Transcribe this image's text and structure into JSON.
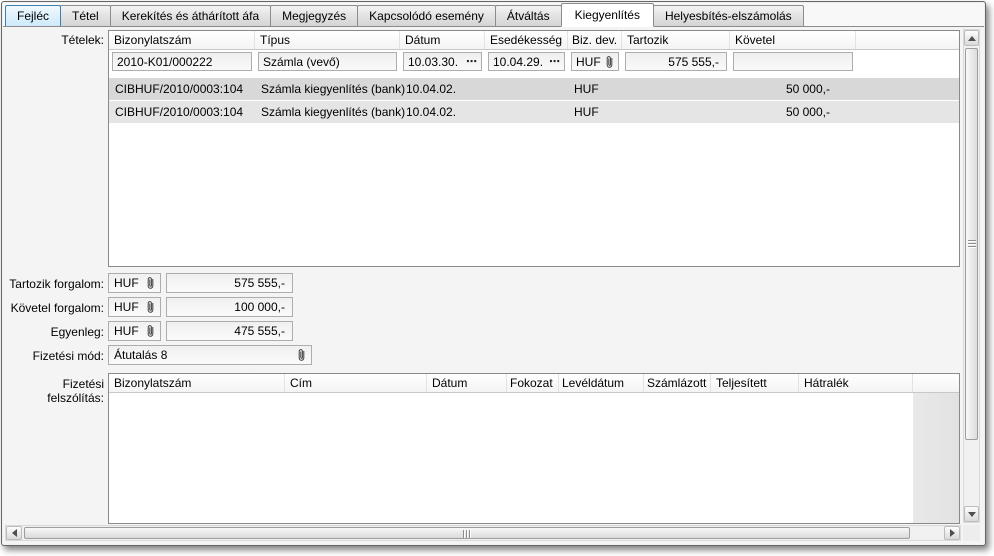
{
  "active_tab": "Kiegyenlítés",
  "tabs": [
    "Fejléc",
    "Tétel",
    "Kerekítés és áthárított áfa",
    "Megjegyzés",
    "Kapcsolódó esemény",
    "Átváltás",
    "Kiegyenlítés",
    "Helyesbítés-elszámolás"
  ],
  "tetelek": {
    "label": "Tételek:",
    "columns": [
      "Bizonylatszám",
      "Típus",
      "Dátum",
      "Esedékesség",
      "Biz. dev.",
      "Tartozik",
      "Követel"
    ],
    "ellipsis": "⋯",
    "editRow": {
      "bizonylatszam": "2010-K01/000222",
      "tipus": "Számla (vevő)",
      "datum": "10.03.30.",
      "esedekesseg": "10.04.29.",
      "bizdev": "HUF",
      "tartozik": "575 555,-",
      "kovetel": ""
    },
    "rows": [
      {
        "bizonylatszam": "CIBHUF/2010/0003:104",
        "tipus": "Számla kiegyenlítés (bank)",
        "datum": "10.04.02.",
        "bizdev": "HUF",
        "kovetel": "50 000,-"
      },
      {
        "bizonylatszam": "CIBHUF/2010/0003:104",
        "tipus": "Számla kiegyenlítés (bank)",
        "datum": "10.04.02.",
        "bizdev": "HUF",
        "kovetel": "50 000,-"
      }
    ]
  },
  "totals": {
    "rows": [
      {
        "label": "Tartozik forgalom:",
        "currency": "HUF",
        "amount": "575 555,-"
      },
      {
        "label": "Követel forgalom:",
        "currency": "HUF",
        "amount": "100 000,-"
      },
      {
        "label": "Egyenleg:",
        "currency": "HUF",
        "amount": "475 555,-"
      }
    ]
  },
  "payment": {
    "label": "Fizetési mód:",
    "value": "Átutalás 8"
  },
  "felszolitas": {
    "label": "Fizetési felszólítás:",
    "columns": [
      "Bizonylatszám",
      "Cím",
      "Dátum",
      "Fokozat",
      "Levéldátum",
      "Számlázott",
      "Teljesített",
      "Hátralék"
    ]
  },
  "colors": {
    "accent": "#3c7fb1",
    "row_dark": "#d8d8d8",
    "row_light": "#e5e5e5"
  }
}
